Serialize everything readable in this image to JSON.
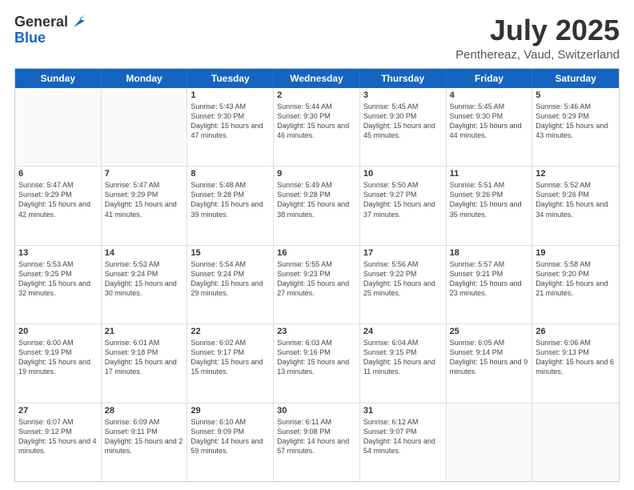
{
  "logo": {
    "general": "General",
    "blue": "Blue"
  },
  "title": "July 2025",
  "subtitle": "Penthereaz, Vaud, Switzerland",
  "header": {
    "days": [
      "Sunday",
      "Monday",
      "Tuesday",
      "Wednesday",
      "Thursday",
      "Friday",
      "Saturday"
    ]
  },
  "weeks": [
    [
      {
        "day": "",
        "empty": true
      },
      {
        "day": "",
        "empty": true
      },
      {
        "day": "1",
        "sunrise": "Sunrise: 5:43 AM",
        "sunset": "Sunset: 9:30 PM",
        "daylight": "Daylight: 15 hours and 47 minutes."
      },
      {
        "day": "2",
        "sunrise": "Sunrise: 5:44 AM",
        "sunset": "Sunset: 9:30 PM",
        "daylight": "Daylight: 15 hours and 46 minutes."
      },
      {
        "day": "3",
        "sunrise": "Sunrise: 5:45 AM",
        "sunset": "Sunset: 9:30 PM",
        "daylight": "Daylight: 15 hours and 45 minutes."
      },
      {
        "day": "4",
        "sunrise": "Sunrise: 5:45 AM",
        "sunset": "Sunset: 9:30 PM",
        "daylight": "Daylight: 15 hours and 44 minutes."
      },
      {
        "day": "5",
        "sunrise": "Sunrise: 5:46 AM",
        "sunset": "Sunset: 9:29 PM",
        "daylight": "Daylight: 15 hours and 43 minutes."
      }
    ],
    [
      {
        "day": "6",
        "sunrise": "Sunrise: 5:47 AM",
        "sunset": "Sunset: 9:29 PM",
        "daylight": "Daylight: 15 hours and 42 minutes."
      },
      {
        "day": "7",
        "sunrise": "Sunrise: 5:47 AM",
        "sunset": "Sunset: 9:29 PM",
        "daylight": "Daylight: 15 hours and 41 minutes."
      },
      {
        "day": "8",
        "sunrise": "Sunrise: 5:48 AM",
        "sunset": "Sunset: 9:28 PM",
        "daylight": "Daylight: 15 hours and 39 minutes."
      },
      {
        "day": "9",
        "sunrise": "Sunrise: 5:49 AM",
        "sunset": "Sunset: 9:28 PM",
        "daylight": "Daylight: 15 hours and 38 minutes."
      },
      {
        "day": "10",
        "sunrise": "Sunrise: 5:50 AM",
        "sunset": "Sunset: 9:27 PM",
        "daylight": "Daylight: 15 hours and 37 minutes."
      },
      {
        "day": "11",
        "sunrise": "Sunrise: 5:51 AM",
        "sunset": "Sunset: 9:26 PM",
        "daylight": "Daylight: 15 hours and 35 minutes."
      },
      {
        "day": "12",
        "sunrise": "Sunrise: 5:52 AM",
        "sunset": "Sunset: 9:26 PM",
        "daylight": "Daylight: 15 hours and 34 minutes."
      }
    ],
    [
      {
        "day": "13",
        "sunrise": "Sunrise: 5:53 AM",
        "sunset": "Sunset: 9:25 PM",
        "daylight": "Daylight: 15 hours and 32 minutes."
      },
      {
        "day": "14",
        "sunrise": "Sunrise: 5:53 AM",
        "sunset": "Sunset: 9:24 PM",
        "daylight": "Daylight: 15 hours and 30 minutes."
      },
      {
        "day": "15",
        "sunrise": "Sunrise: 5:54 AM",
        "sunset": "Sunset: 9:24 PM",
        "daylight": "Daylight: 15 hours and 29 minutes."
      },
      {
        "day": "16",
        "sunrise": "Sunrise: 5:55 AM",
        "sunset": "Sunset: 9:23 PM",
        "daylight": "Daylight: 15 hours and 27 minutes."
      },
      {
        "day": "17",
        "sunrise": "Sunrise: 5:56 AM",
        "sunset": "Sunset: 9:22 PM",
        "daylight": "Daylight: 15 hours and 25 minutes."
      },
      {
        "day": "18",
        "sunrise": "Sunrise: 5:57 AM",
        "sunset": "Sunset: 9:21 PM",
        "daylight": "Daylight: 15 hours and 23 minutes."
      },
      {
        "day": "19",
        "sunrise": "Sunrise: 5:58 AM",
        "sunset": "Sunset: 9:20 PM",
        "daylight": "Daylight: 15 hours and 21 minutes."
      }
    ],
    [
      {
        "day": "20",
        "sunrise": "Sunrise: 6:00 AM",
        "sunset": "Sunset: 9:19 PM",
        "daylight": "Daylight: 15 hours and 19 minutes."
      },
      {
        "day": "21",
        "sunrise": "Sunrise: 6:01 AM",
        "sunset": "Sunset: 9:18 PM",
        "daylight": "Daylight: 15 hours and 17 minutes."
      },
      {
        "day": "22",
        "sunrise": "Sunrise: 6:02 AM",
        "sunset": "Sunset: 9:17 PM",
        "daylight": "Daylight: 15 hours and 15 minutes."
      },
      {
        "day": "23",
        "sunrise": "Sunrise: 6:03 AM",
        "sunset": "Sunset: 9:16 PM",
        "daylight": "Daylight: 15 hours and 13 minutes."
      },
      {
        "day": "24",
        "sunrise": "Sunrise: 6:04 AM",
        "sunset": "Sunset: 9:15 PM",
        "daylight": "Daylight: 15 hours and 11 minutes."
      },
      {
        "day": "25",
        "sunrise": "Sunrise: 6:05 AM",
        "sunset": "Sunset: 9:14 PM",
        "daylight": "Daylight: 15 hours and 9 minutes."
      },
      {
        "day": "26",
        "sunrise": "Sunrise: 6:06 AM",
        "sunset": "Sunset: 9:13 PM",
        "daylight": "Daylight: 15 hours and 6 minutes."
      }
    ],
    [
      {
        "day": "27",
        "sunrise": "Sunrise: 6:07 AM",
        "sunset": "Sunset: 9:12 PM",
        "daylight": "Daylight: 15 hours and 4 minutes."
      },
      {
        "day": "28",
        "sunrise": "Sunrise: 6:09 AM",
        "sunset": "Sunset: 9:11 PM",
        "daylight": "Daylight: 15 hours and 2 minutes."
      },
      {
        "day": "29",
        "sunrise": "Sunrise: 6:10 AM",
        "sunset": "Sunset: 9:09 PM",
        "daylight": "Daylight: 14 hours and 59 minutes."
      },
      {
        "day": "30",
        "sunrise": "Sunrise: 6:11 AM",
        "sunset": "Sunset: 9:08 PM",
        "daylight": "Daylight: 14 hours and 57 minutes."
      },
      {
        "day": "31",
        "sunrise": "Sunrise: 6:12 AM",
        "sunset": "Sunset: 9:07 PM",
        "daylight": "Daylight: 14 hours and 54 minutes."
      },
      {
        "day": "",
        "empty": true
      },
      {
        "day": "",
        "empty": true
      }
    ]
  ]
}
